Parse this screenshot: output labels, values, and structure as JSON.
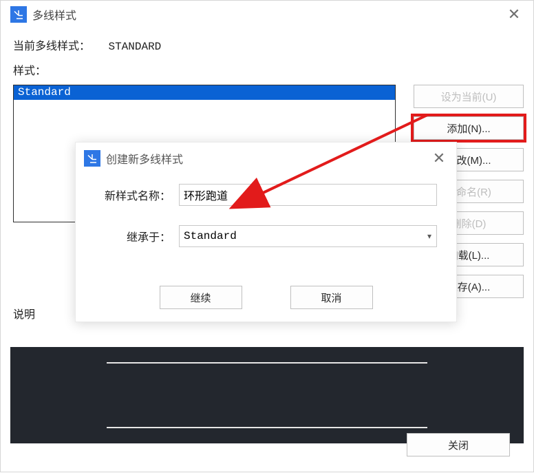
{
  "parent": {
    "title": "多线样式",
    "current_label": "当前多线样式：",
    "current_value": "STANDARD",
    "styles_label": "样式：",
    "styles_items": [
      "Standard"
    ],
    "desc_label": "说明",
    "buttons": {
      "set_current": "设为当前(U)",
      "add": "添加(N)...",
      "modify": "修改(M)...",
      "rename": "重命名(R)",
      "delete": "删除(D)",
      "load": "加载(L)...",
      "save": "保存(A)...",
      "close": "关闭"
    }
  },
  "modal": {
    "title": "创建新多线样式",
    "new_name_label": "新样式名称：",
    "new_name_value": "环形跑道",
    "inherit_label": "继承于：",
    "inherit_value": "Standard",
    "continue": "继续",
    "cancel": "取消"
  }
}
